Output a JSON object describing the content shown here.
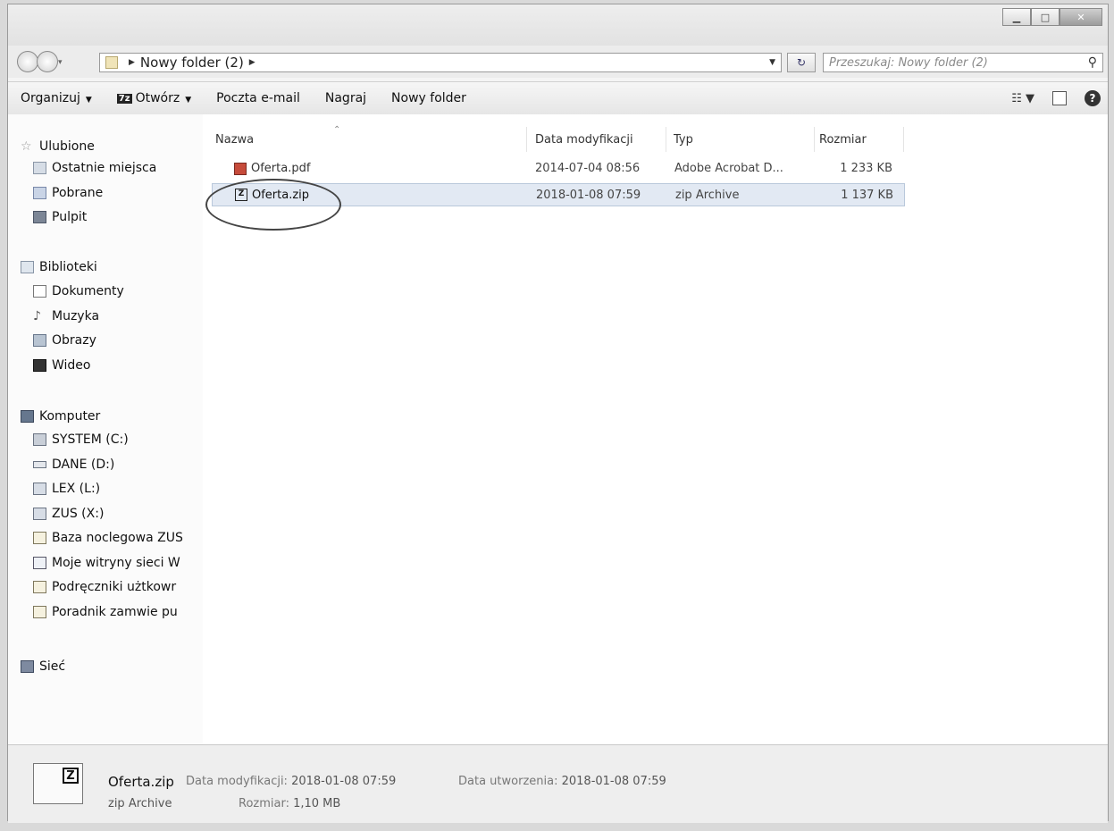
{
  "window": {
    "minimize_icon": "minimize-icon",
    "maximize_icon": "maximize-icon",
    "close_icon": "close-icon"
  },
  "address": {
    "crumb": "Nowy folder (2)"
  },
  "search": {
    "placeholder": "Przeszukaj: Nowy folder (2)"
  },
  "toolbar": {
    "organize": "Organizuj",
    "open": "Otwórz",
    "open_icon_text": "7z",
    "email": "Poczta e-mail",
    "burn": "Nagraj",
    "new_folder": "Nowy folder"
  },
  "sidebar": {
    "favorites": {
      "label": "Ulubione",
      "items": [
        "Ostatnie miejsca",
        "Pobrane",
        "Pulpit"
      ]
    },
    "libraries": {
      "label": "Biblioteki",
      "items": [
        "Dokumenty",
        "Muzyka",
        "Obrazy",
        "Wideo"
      ]
    },
    "computer": {
      "label": "Komputer",
      "items": [
        "SYSTEM (C:)",
        "DANE (D:)",
        "LEX (L:)",
        "ZUS (X:)",
        "Baza noclegowa ZUS",
        "Moje witryny sieci W",
        "Podręczniki użtkowr",
        "Poradnik zamwie pu"
      ]
    },
    "network": {
      "label": "Sieć"
    }
  },
  "columns": {
    "name": "Nazwa",
    "modified": "Data modyfikacji",
    "type": "Typ",
    "size": "Rozmiar"
  },
  "files": [
    {
      "name": "Oferta.pdf",
      "modified": "2014-07-04 08:56",
      "type": "Adobe Acrobat D...",
      "size": "1 233 KB"
    },
    {
      "name": "Oferta.zip",
      "modified": "2018-01-08 07:59",
      "type": "zip Archive",
      "size": "1 137 KB",
      "selected": true
    }
  ],
  "details": {
    "name": "Oferta.zip",
    "type": "zip Archive",
    "modified_label": "Data modyfikacji:",
    "modified": "2018-01-08 07:59",
    "size_label": "Rozmiar:",
    "size": "1,10 MB",
    "created_label": "Data utworzenia:",
    "created": "2018-01-08 07:59",
    "icon_text": "Z"
  }
}
